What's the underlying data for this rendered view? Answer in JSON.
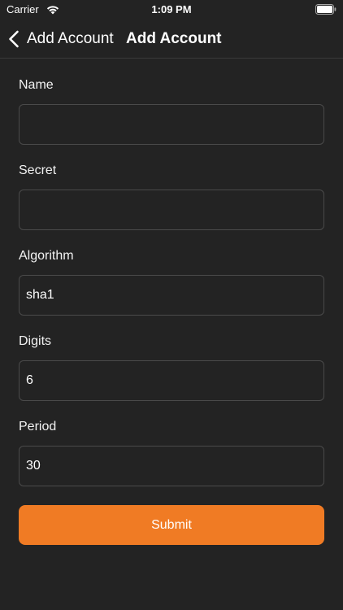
{
  "status_bar": {
    "carrier": "Carrier",
    "time": "1:09 PM"
  },
  "nav": {
    "back_label": "Add Account",
    "title": "Add Account"
  },
  "form": {
    "fields": [
      {
        "label": "Name",
        "value": "",
        "placeholder": ""
      },
      {
        "label": "Secret",
        "value": "",
        "placeholder": ""
      },
      {
        "label": "Algorithm",
        "value": "sha1",
        "placeholder": ""
      },
      {
        "label": "Digits",
        "value": "6",
        "placeholder": ""
      },
      {
        "label": "Period",
        "value": "30",
        "placeholder": ""
      }
    ],
    "submit_label": "Submit"
  },
  "colors": {
    "background": "#232323",
    "accent": "#f07b24",
    "input_border": "#4a4a4a"
  }
}
